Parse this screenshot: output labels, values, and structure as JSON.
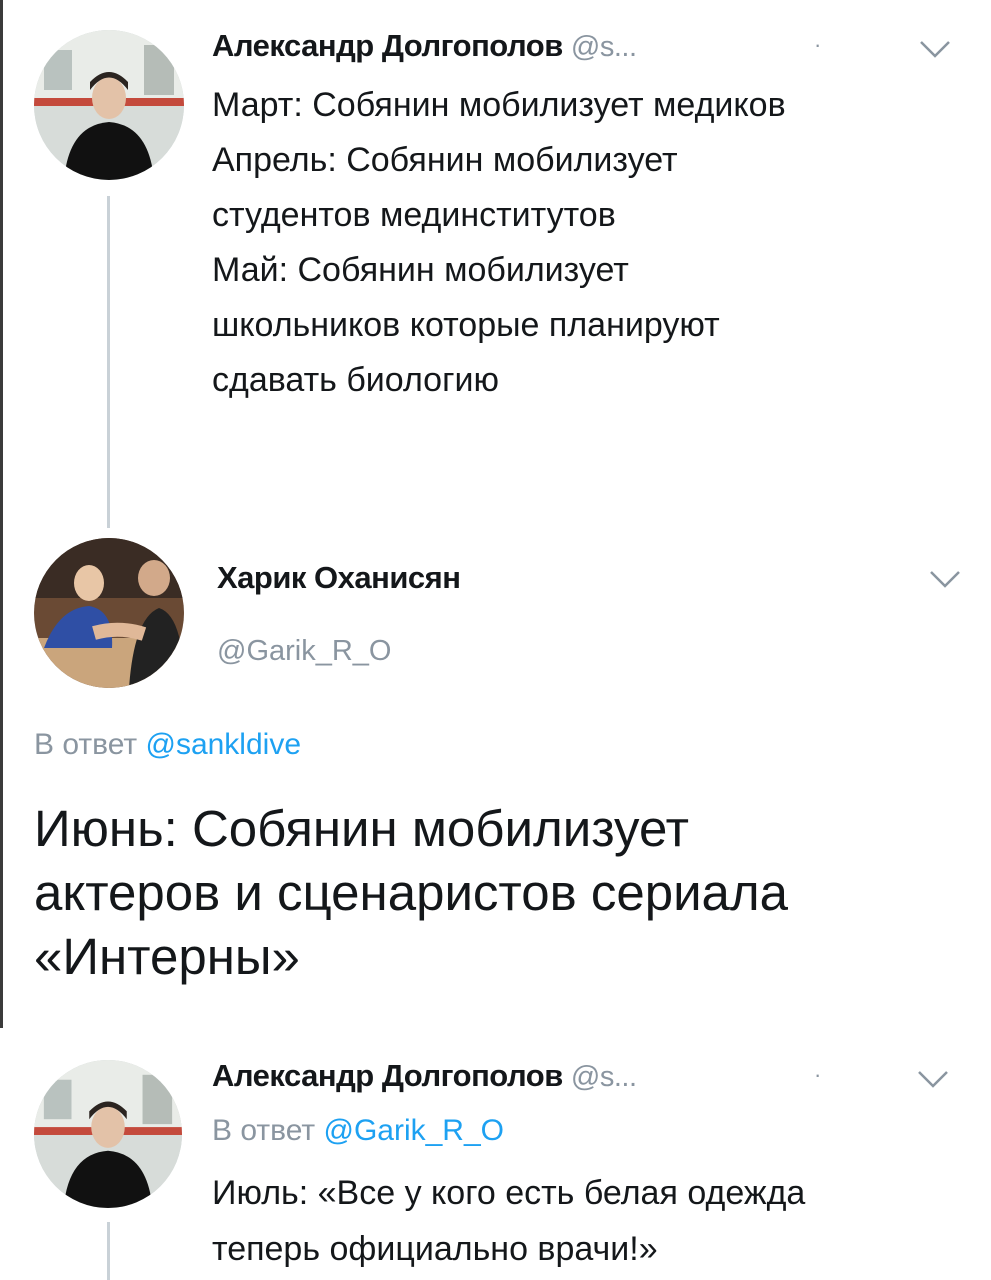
{
  "tweets": [
    {
      "author": "Александр Долгополов",
      "handle": "@s...",
      "separator": "·",
      "lines": "Март: Собянин мобилизует медиков\nАпрель: Собянин мобилизует\nстудентов мединститутов\nМай: Собянин мобилизует\nшкольников которые планируют\nсдавать биологию"
    },
    {
      "author": "Харик Оханисян",
      "handle": "@Garik_R_O",
      "reply_prefix": "В ответ",
      "reply_to": "@sankldive",
      "lines": "Июнь: Собянин мобилизует\nактеров и сценаристов сериала\n«Интерны»"
    },
    {
      "author": "Александр Долгополов",
      "handle": "@s...",
      "separator": "·",
      "reply_prefix": "В ответ",
      "reply_to": "@Garik_R_O",
      "lines": "Июль: «Все у кого есть белая одежда\nтеперь официально врачи!»"
    }
  ],
  "icons": {
    "chevron": "chevron-down-icon"
  },
  "colors": {
    "link": "#1da1f2",
    "secondary_text": "#8a95a0",
    "thread_line": "#c9d1d7"
  }
}
